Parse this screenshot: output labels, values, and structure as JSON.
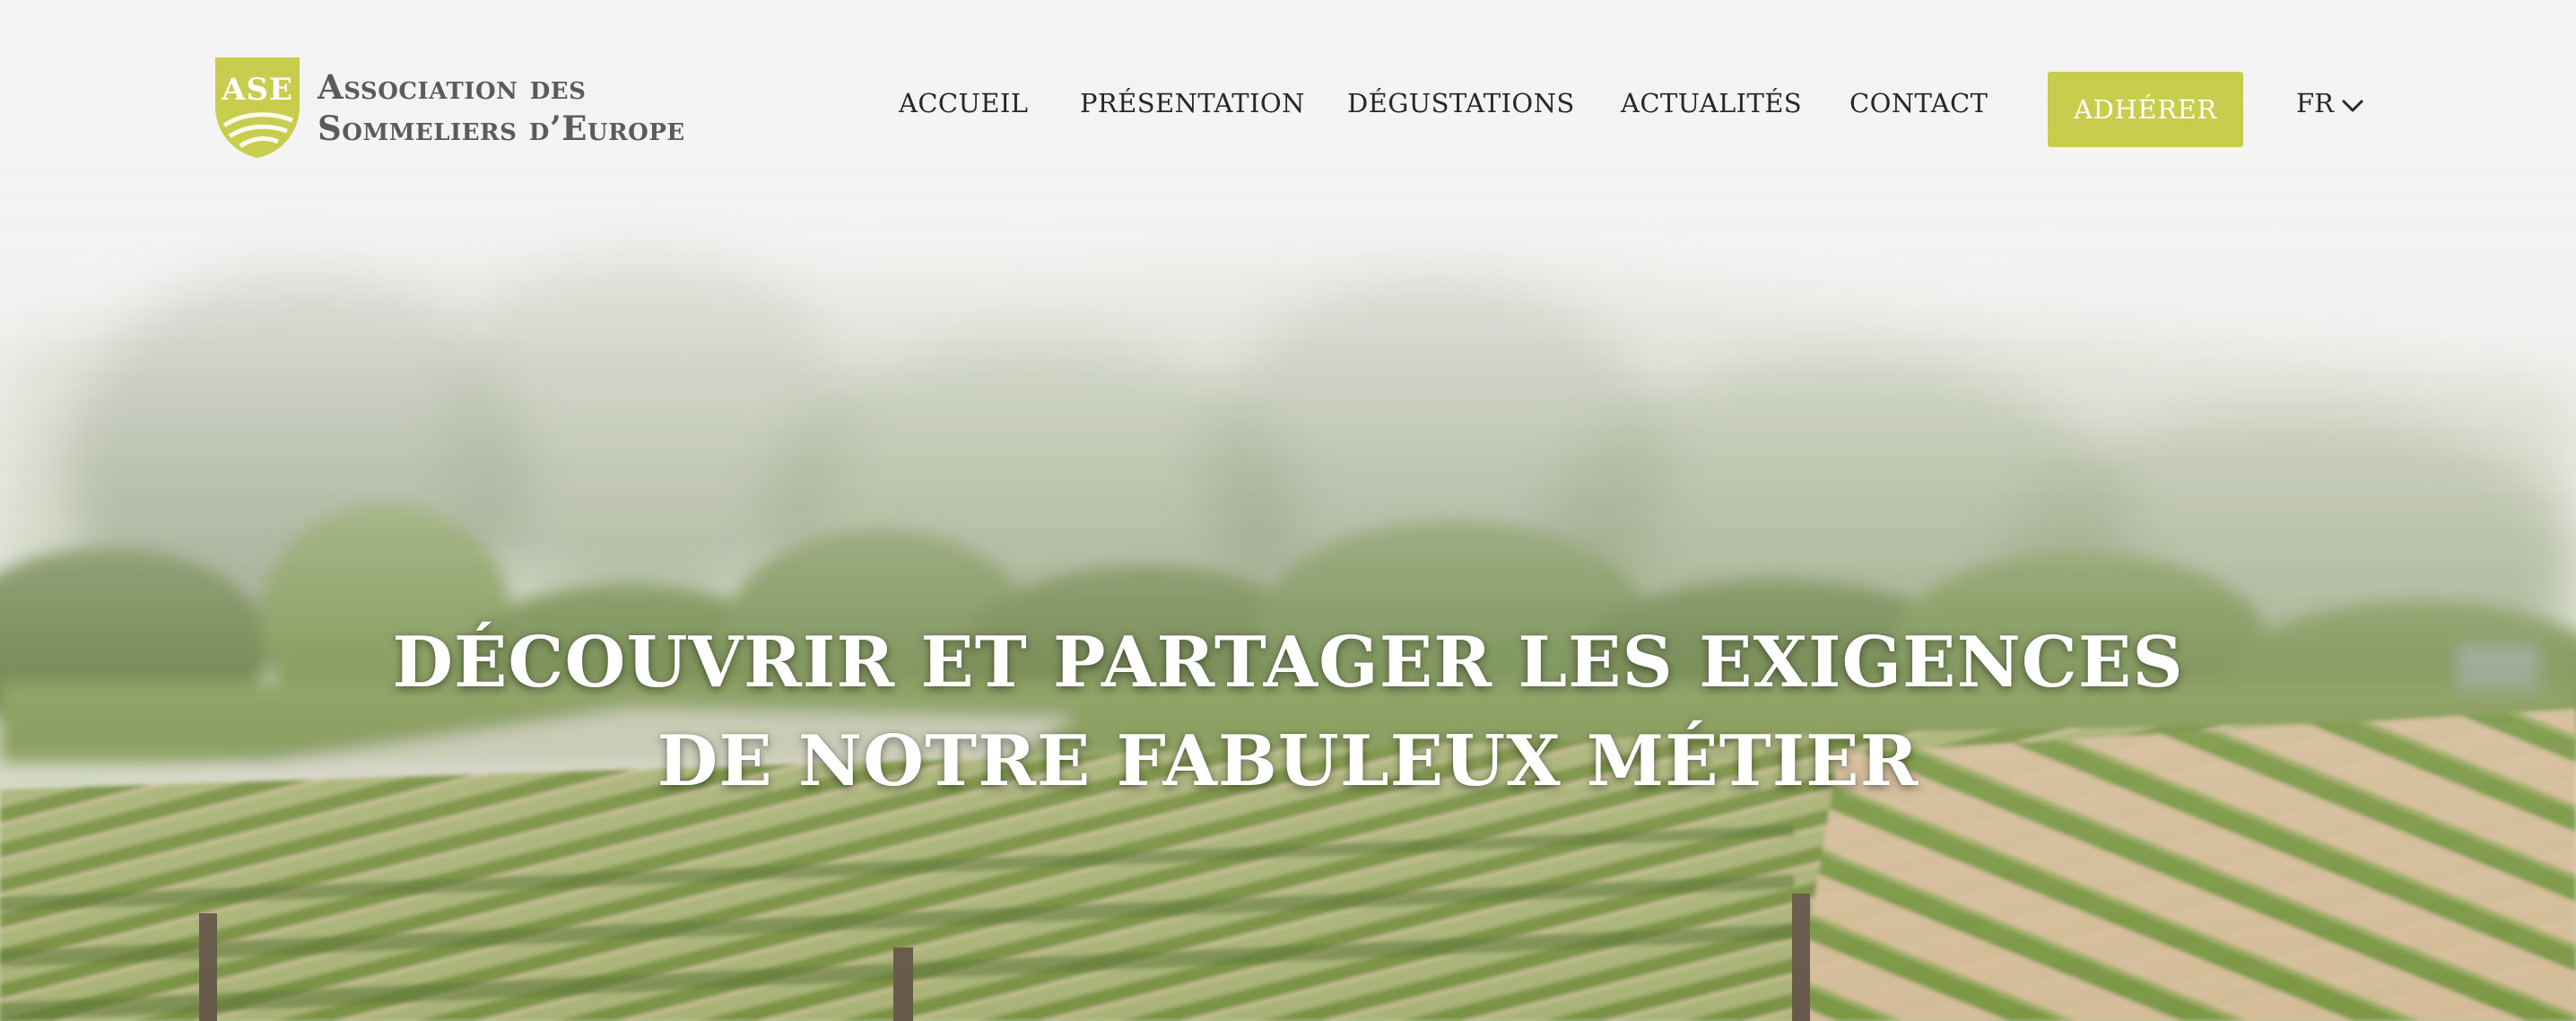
{
  "colors": {
    "accent": "#c9cd4d",
    "nav_text": "#2b2626",
    "brand_text": "#5e5a5b",
    "headline_text": "#ffffff"
  },
  "brand": {
    "initials": "ASE",
    "line1": "Association des",
    "line2": "Sommeliers d’Europe",
    "icon": "shield-logo-icon"
  },
  "nav": {
    "items": [
      {
        "label": "ACCUEIL"
      },
      {
        "label": "PRÉSENTATION"
      },
      {
        "label": "DÉGUSTATIONS"
      },
      {
        "label": "ACTUALITÉS"
      },
      {
        "label": "CONTACT"
      }
    ],
    "cta_label": "ADHÉRER",
    "language": "FR",
    "language_icon": "chevron-down-icon"
  },
  "hero": {
    "headline_line1": "DÉCOUVRIR ET PARTAGER LES EXIGENCES",
    "headline_line2": "DE NOTRE FABULEUX MÉTIER"
  }
}
